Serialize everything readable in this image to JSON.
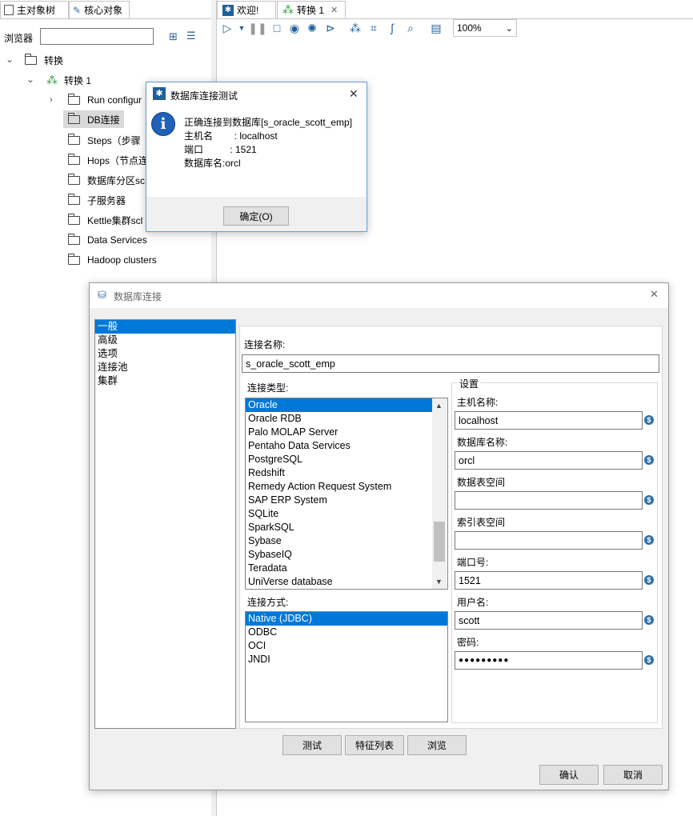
{
  "left_panel": {
    "tabs": [
      "主对象树",
      "核心对象"
    ],
    "browser_label": "浏览器",
    "browser_value": "",
    "tree": {
      "root": "转换",
      "trans": "转换 1",
      "items": [
        "Run configurations",
        "DB连接",
        "Steps（步骤）",
        "Hops（节点连接）",
        "数据库分区schemas",
        "子服务器",
        "Kettle集群schemas",
        "Data Services",
        "Hadoop clusters"
      ],
      "items_visible": [
        "Run configur",
        "DB连接",
        "Steps（步骤",
        "Hops（节点连",
        "数据库分区sc",
        "子服务器",
        "Kettle集群scl",
        "Data Services",
        "Hadoop clusters"
      ]
    }
  },
  "editor": {
    "tabs": [
      "欢迎!",
      "转换 1"
    ],
    "zoom": "100%"
  },
  "test_dialog": {
    "title": "数据库连接测试",
    "lines": [
      "正确连接到数据库[s_oracle_scott_emp]",
      "主机名        : localhost",
      "端口          : 1521",
      "数据库名:orcl"
    ],
    "ok_button": "确定(O)"
  },
  "db_dialog": {
    "title": "数据库连接",
    "categories": [
      "一般",
      "高级",
      "选项",
      "连接池",
      "集群"
    ],
    "conn_name_label": "连接名称:",
    "conn_name_value": "s_oracle_scott_emp",
    "conn_type_label": "连接类型:",
    "conn_types": [
      "Oracle",
      "Oracle RDB",
      "Palo MOLAP Server",
      "Pentaho Data Services",
      "PostgreSQL",
      "Redshift",
      "Remedy Action Request System",
      "SAP ERP System",
      "SQLite",
      "SparkSQL",
      "Sybase",
      "SybaseIQ",
      "Teradata",
      "UniVerse database"
    ],
    "access_label": "连接方式:",
    "access_types": [
      "Native (JDBC)",
      "ODBC",
      "OCI",
      "JNDI"
    ],
    "settings_label": "设置",
    "host_label": "主机名称:",
    "host_value": "localhost",
    "dbname_label": "数据库名称:",
    "dbname_value": "orcl",
    "tablespace_label": "数据表空间",
    "tablespace_value": "",
    "indexspace_label": "索引表空间",
    "indexspace_value": "",
    "port_label": "端口号:",
    "port_value": "1521",
    "user_label": "用户名:",
    "user_value": "scott",
    "password_label": "密码:",
    "password_value": "●●●●●●●●●",
    "buttons": {
      "test": "测试",
      "features": "特征列表",
      "explore": "浏览",
      "ok": "确认",
      "cancel": "取消"
    }
  }
}
